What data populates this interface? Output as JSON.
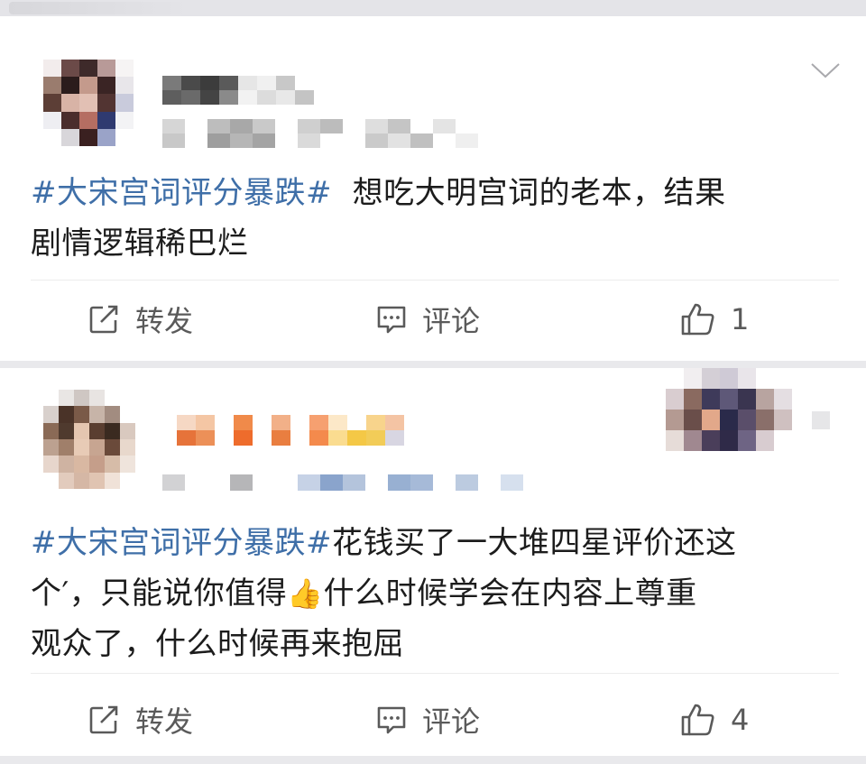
{
  "posts": [
    {
      "hashtag": "#大宋宫词评分暴跌#",
      "text_line1": "想吃大明宫词的老本，结果",
      "text_line2": "剧情逻辑稀巴烂",
      "actions": {
        "repost_label": "转发",
        "comment_label": "评论",
        "like_count": "1"
      }
    },
    {
      "hashtag": "#大宋宫词评分暴跌#",
      "text_line1_rest": "花钱买了一大堆四星评价还这",
      "text_line2_pre": "个′，只能说你值得",
      "emoji": "👍",
      "text_line2_post": "什么时候学会在内容上尊重",
      "text_line3": "观众了，什么时候再来抱屈",
      "actions": {
        "repost_label": "转发",
        "comment_label": "评论",
        "like_count": "4"
      }
    }
  ],
  "icons": {
    "repost": "edit-square-icon",
    "comment": "comment-bubble-icon",
    "like": "thumbs-up-icon",
    "menu": "chevron-down-icon"
  },
  "colors": {
    "hashtag": "#3f6fa8",
    "icon": "#5a5a5a",
    "background": "#e9e9ec"
  }
}
